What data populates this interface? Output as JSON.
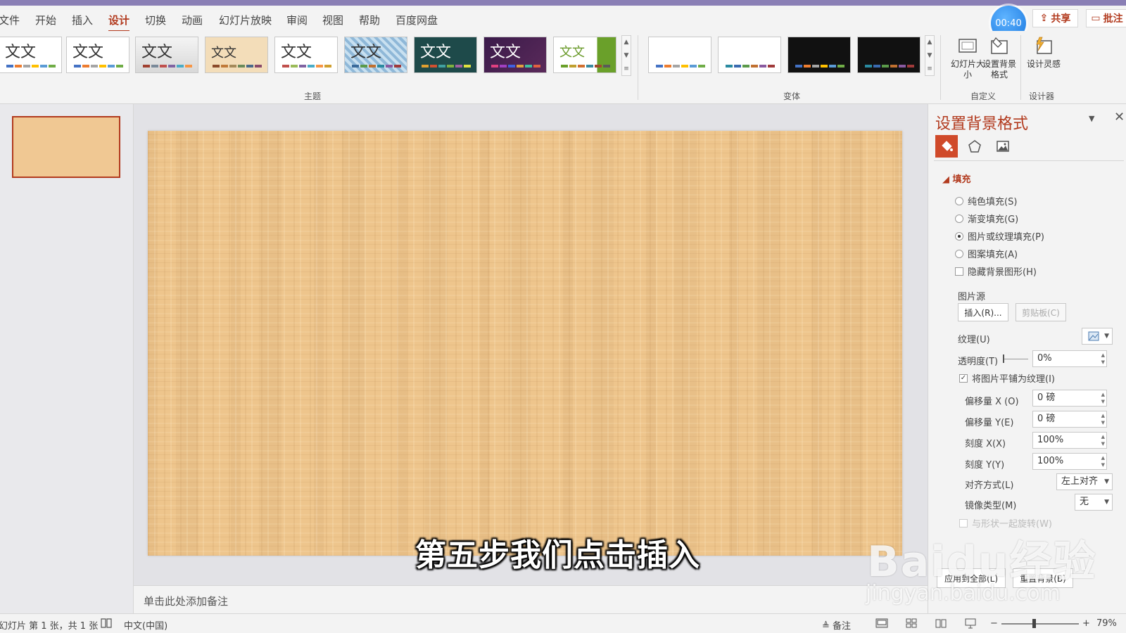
{
  "menu": {
    "items": [
      "文件",
      "开始",
      "插入",
      "设计",
      "切换",
      "动画",
      "幻灯片放映",
      "审阅",
      "视图",
      "帮助",
      "百度网盘"
    ],
    "active": "设计"
  },
  "timer": "00:40",
  "share_label": "共享",
  "comment_label": "批注",
  "ribbon": {
    "themes_label": "主题",
    "variants_label": "变体",
    "customize_label": "自定义",
    "designer_label": "设计器",
    "theme_text": "文文",
    "slide_size_label": "幻灯片大小",
    "format_bg_label": "设置背景格式",
    "design_ideas_label": "设计灵感"
  },
  "subtitle": "第五步我们点击插入",
  "notes_placeholder": "单击此处添加备注",
  "pane": {
    "title": "设置背景格式",
    "fill_section": "填充",
    "options": {
      "solid": "纯色填充(S)",
      "gradient": "渐变填充(G)",
      "picture": "图片或纹理填充(P)",
      "pattern": "图案填充(A)",
      "hide_graphics": "隐藏背景图形(H)"
    },
    "picture_source": "图片源",
    "insert_button": "插入(R)...",
    "clipboard_button": "剪贴板(C)",
    "texture_label": "纹理(U)",
    "transparency_label": "透明度(T)",
    "transparency_value": "0%",
    "tile_label": "将图片平铺为纹理(I)",
    "offset_x_label": "偏移量 X (O)",
    "offset_x_value": "0 磅",
    "offset_y_label": "偏移量 Y(E)",
    "offset_y_value": "0 磅",
    "scale_x_label": "刻度 X(X)",
    "scale_x_value": "100%",
    "scale_y_label": "刻度 Y(Y)",
    "scale_y_value": "100%",
    "align_label": "对齐方式(L)",
    "align_value": "左上对齐",
    "mirror_label": "镜像类型(M)",
    "mirror_value": "无",
    "rotate_label": "与形状一起旋转(W)",
    "apply_all_button": "应用到全部(L)",
    "reset_button": "重置背景(B)"
  },
  "status": {
    "slide_info": "幻灯片 第 1 张，共 1 张",
    "language": "中文(中国)",
    "notes_label": "备注",
    "zoom": "79%"
  },
  "watermark": {
    "brand": "Baidu经验",
    "url": "jingyan.baidu.com"
  },
  "colors": {
    "accent": "#b23a1e",
    "slide_bg": "#eec58c"
  }
}
